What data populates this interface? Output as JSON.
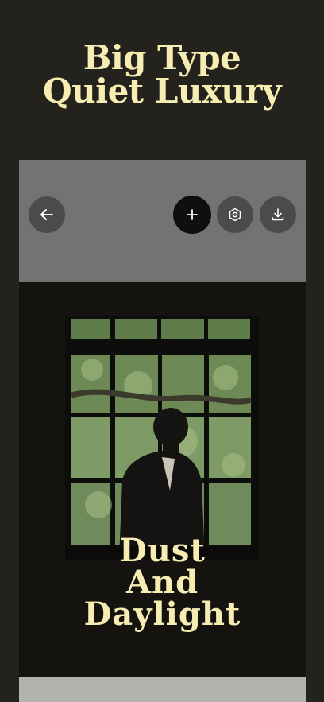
{
  "hero": {
    "line1": "Big Type",
    "line2": "Quiet Luxury"
  },
  "toolbar": {
    "back_icon": "arrow-left-icon",
    "add_icon": "plus-icon",
    "settings_icon": "hexagon-settings-icon",
    "download_icon": "download-icon"
  },
  "card": {
    "caption_line1": "Dust",
    "caption_line2": "And",
    "caption_line3": "Daylight"
  },
  "colors": {
    "background": "#24221d",
    "accent_text": "#f7ecb2",
    "toolbar": "#737373",
    "add_button": "#0f0f0f"
  }
}
